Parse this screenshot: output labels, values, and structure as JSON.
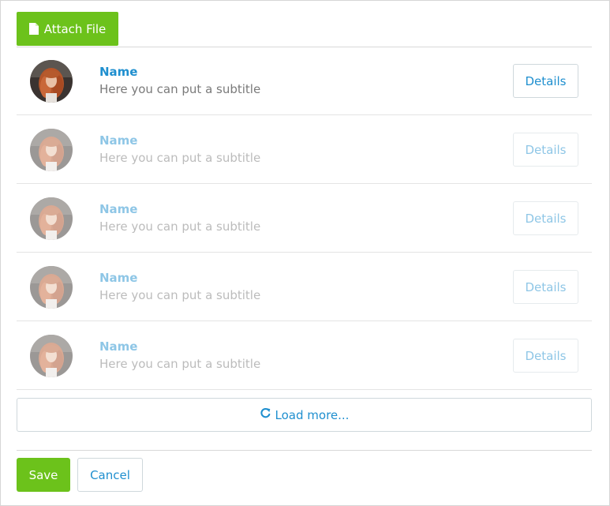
{
  "toolbar": {
    "attach_label": "Attach File",
    "attach_icon": "file-icon"
  },
  "list": {
    "items": [
      {
        "name": "Name",
        "subtitle": "Here you can put a subtitle",
        "action": "Details",
        "faded": false
      },
      {
        "name": "Name",
        "subtitle": "Here you can put a subtitle",
        "action": "Details",
        "faded": true
      },
      {
        "name": "Name",
        "subtitle": "Here you can put a subtitle",
        "action": "Details",
        "faded": true
      },
      {
        "name": "Name",
        "subtitle": "Here you can put a subtitle",
        "action": "Details",
        "faded": true
      },
      {
        "name": "Name",
        "subtitle": "Here you can put a subtitle",
        "action": "Details",
        "faded": true
      }
    ],
    "load_more_label": "Load more...",
    "load_more_icon": "refresh-icon"
  },
  "footer": {
    "save_label": "Save",
    "cancel_label": "Cancel"
  },
  "colors": {
    "primary_green": "#6cc21b",
    "link_blue": "#1f8fcf",
    "subtitle_gray": "#7a7a7a",
    "border_gray": "#cfd8dc"
  }
}
